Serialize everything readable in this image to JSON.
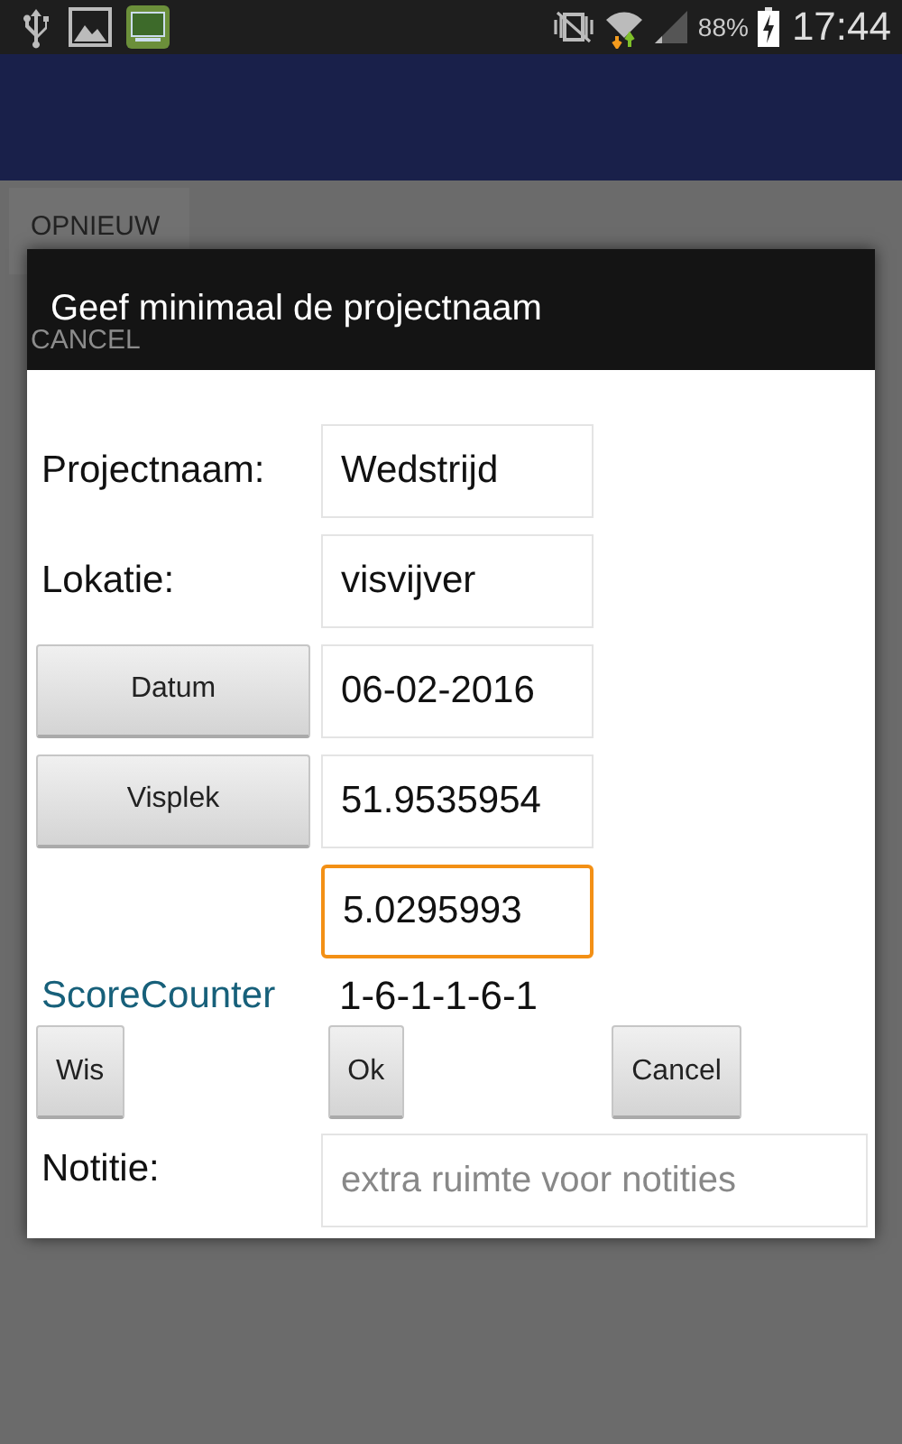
{
  "status_bar": {
    "battery": "88%",
    "time": "17:44"
  },
  "background_buttons": [
    "OPNIEUW",
    "CANCEL"
  ],
  "dialog": {
    "title": "Geef minimaal de projectnaam",
    "rows": [
      {
        "kind": "label",
        "label": "Projectnaam:",
        "value": "Wedstrijd",
        "focused": false
      },
      {
        "kind": "label",
        "label": "Lokatie:",
        "value": "visvijver",
        "focused": false
      },
      {
        "kind": "button",
        "label": "Datum",
        "value": "06-02-2016",
        "focused": false
      },
      {
        "kind": "button",
        "label": "Visplek",
        "value": "51.9535954",
        "focused": false
      },
      {
        "kind": "none",
        "value": "5.0295993",
        "focused": true
      }
    ],
    "score": {
      "label": "ScoreCounter",
      "value": "1-6-1-1-6-1"
    },
    "buttons": [
      "Wis",
      "Ok",
      "Cancel"
    ],
    "note": {
      "label": "Notitie:",
      "placeholder": "extra ruimte voor notities"
    }
  }
}
